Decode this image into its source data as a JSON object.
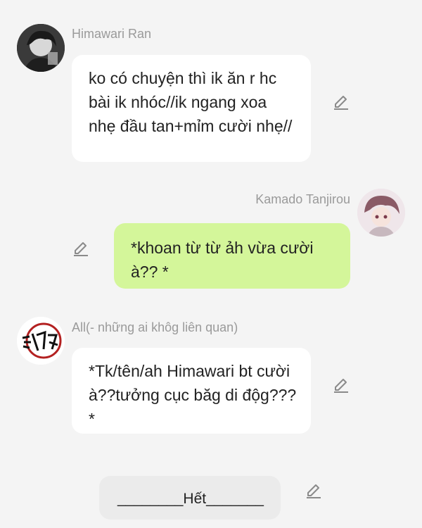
{
  "messages": [
    {
      "sender": "Himawari Ran",
      "text": "ko có chuyện thì ik ăn r hc bài ik nhóc//ik ngang xoa nhẹ đầu tan+mỉm cười nhẹ//",
      "side": "left",
      "bubble_color": "#ffffff",
      "avatar_icon": "dark-haired-boy-avatar"
    },
    {
      "sender": "Kamado Tanjirou",
      "text": "*khoan từ từ ảh vừa cười à?? *",
      "side": "right",
      "bubble_color": "#d4f69a",
      "avatar_icon": "tanjirou-avatar"
    },
    {
      "sender": "All(- những ai khôg liên quan)",
      "text": "*Tk/tên/ah Himawari bt cười à??tưởng cục băg di độg??? *",
      "side": "left",
      "bubble_color": "#ffffff",
      "avatar_icon": "demon-slayer-logo-avatar"
    }
  ],
  "footer": {
    "text": "________Hết_______",
    "bubble_color": "#ebebeb"
  },
  "icons": {
    "edit": "pencil-edit-icon"
  },
  "colors": {
    "background": "#f4f4f4",
    "name_text": "#9a9a9a",
    "icon": "#8a8a8a"
  }
}
